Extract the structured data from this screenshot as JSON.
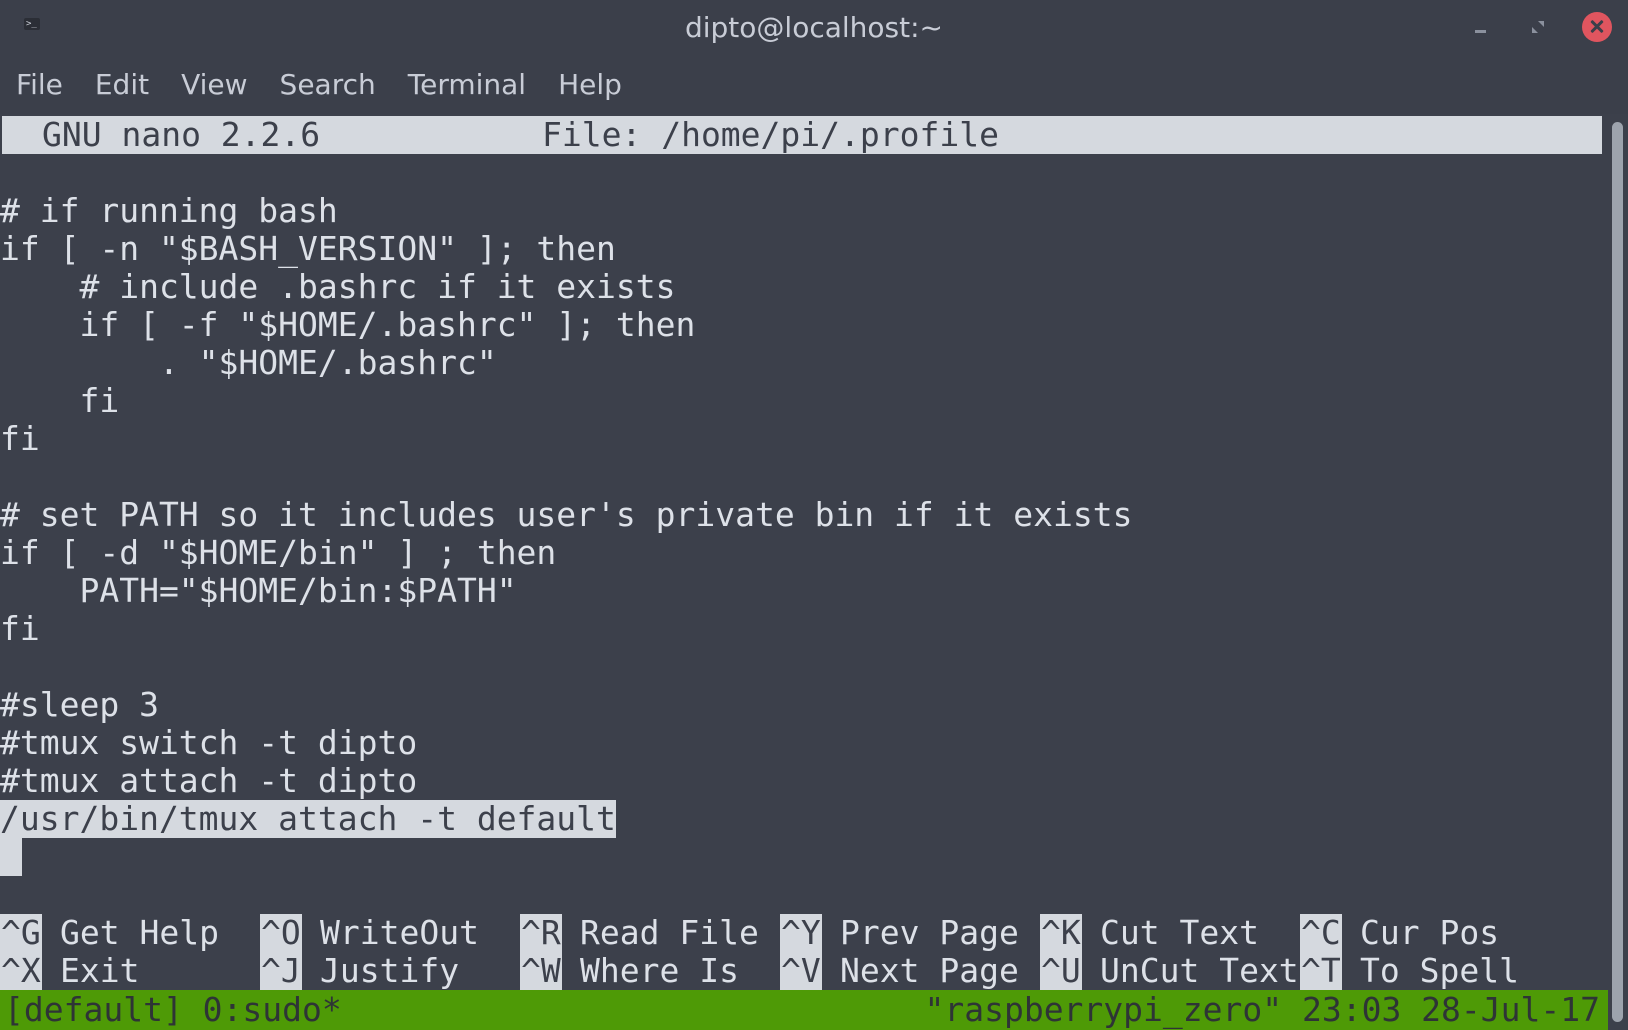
{
  "window": {
    "title": "dipto@localhost:~",
    "app_icon": ">_"
  },
  "menu": [
    "File",
    "Edit",
    "View",
    "Search",
    "Terminal",
    "Help"
  ],
  "nano": {
    "version": "GNU nano 2.2.6",
    "file": "File: /home/pi/.profile"
  },
  "file_lines": [
    "",
    "# if running bash",
    "if [ -n \"$BASH_VERSION\" ]; then",
    "    # include .bashrc if it exists",
    "    if [ -f \"$HOME/.bashrc\" ]; then",
    "        . \"$HOME/.bashrc\"",
    "    fi",
    "fi",
    "",
    "# set PATH so it includes user's private bin if it exists",
    "if [ -d \"$HOME/bin\" ] ; then",
    "    PATH=\"$HOME/bin:$PATH\"",
    "fi",
    "",
    "#sleep 3",
    "#tmux switch -t dipto",
    "#tmux attach -t dipto"
  ],
  "selected_line": "/usr/bin/tmux attach -t default",
  "shortcuts": {
    "row1": [
      {
        "key": "^G",
        "label": "Get Help"
      },
      {
        "key": "^O",
        "label": "WriteOut"
      },
      {
        "key": "^R",
        "label": "Read File"
      },
      {
        "key": "^Y",
        "label": "Prev Page"
      },
      {
        "key": "^K",
        "label": "Cut Text"
      },
      {
        "key": "^C",
        "label": "Cur Pos"
      }
    ],
    "row2": [
      {
        "key": "^X",
        "label": "Exit"
      },
      {
        "key": "^J",
        "label": "Justify"
      },
      {
        "key": "^W",
        "label": "Where Is"
      },
      {
        "key": "^V",
        "label": "Next Page"
      },
      {
        "key": "^U",
        "label": "UnCut Text"
      },
      {
        "key": "^T",
        "label": "To Spell"
      }
    ]
  },
  "tmux": {
    "left": "[default] 0:sudo*",
    "right": "\"raspberrypi_zero\" 23:03 28-Jul-17"
  },
  "colors": {
    "terminal_bg": "#3c404b",
    "text": "#dde1e8",
    "highlight_bg": "#d5d9df",
    "tmux_bar": "#4e9a06",
    "close_button": "#e0555f"
  }
}
